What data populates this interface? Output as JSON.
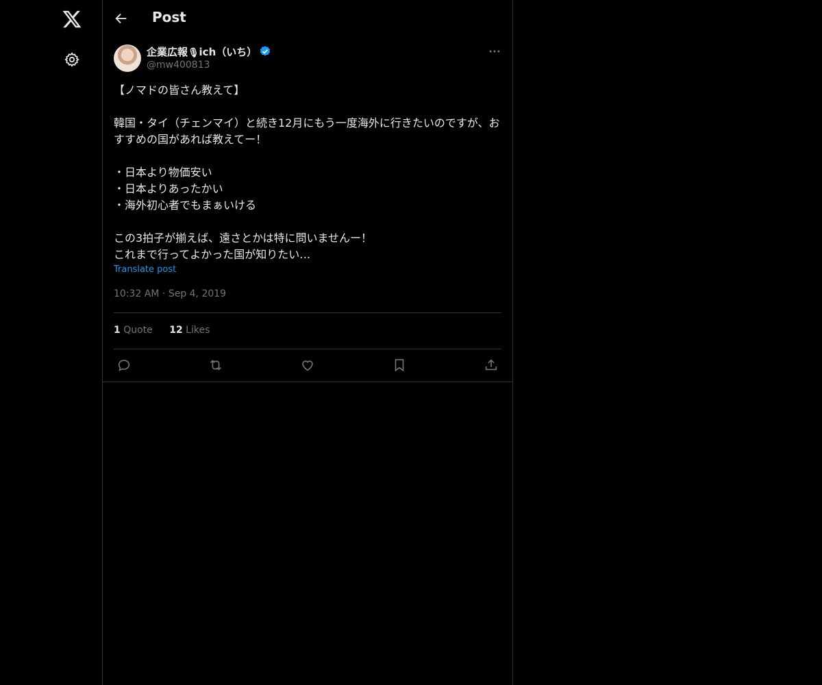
{
  "header": {
    "title": "Post"
  },
  "author": {
    "display_name_prefix": "企業広報",
    "display_name_emoji": "🎙",
    "display_name_suffix": "ich（いち）",
    "handle": "@mw400813"
  },
  "post": {
    "text": "【ノマドの皆さん教えて】\n\n韓国・タイ（チェンマイ）と続き12月にもう一度海外に行きたいのですが、おすすめの国があれば教えてー！\n\n・日本より物価安い\n・日本よりあったかい\n・海外初心者でもまぁいける\n\nこの3拍子が揃えば、遠さとかは特に問いませんー！\nこれまで行ってよかった国が知りたい…",
    "translate_label": "Translate post",
    "time": "10:32 AM",
    "date": "Sep 4, 2019",
    "separator": "·"
  },
  "stats": {
    "quotes_count": "1",
    "quotes_label": "Quote",
    "likes_count": "12",
    "likes_label": "Likes"
  },
  "colors": {
    "accent": "#1d9bf0",
    "background": "#000000",
    "muted": "#71767b",
    "border": "#2f3336"
  },
  "icons": [
    "x-logo-icon",
    "settings-icon",
    "back-arrow-icon",
    "verified-badge-icon",
    "more-icon",
    "reply-icon",
    "repost-icon",
    "like-icon",
    "bookmark-icon",
    "share-icon"
  ]
}
